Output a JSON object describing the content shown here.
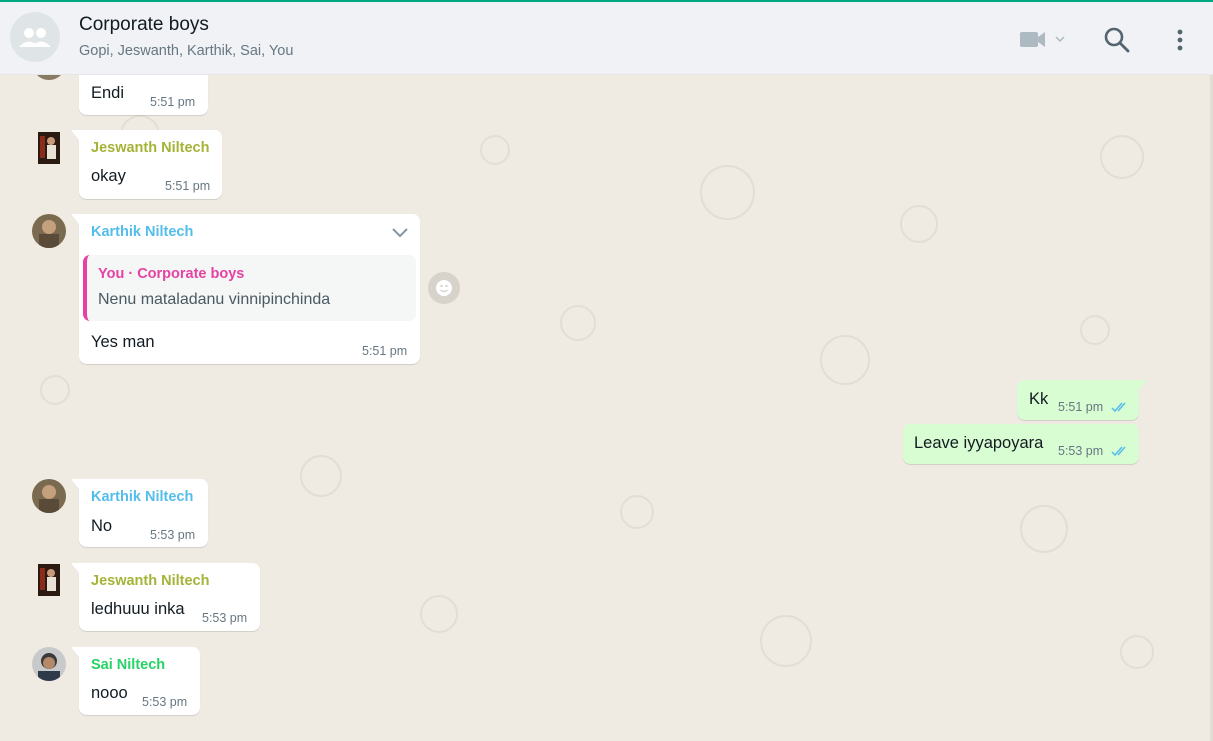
{
  "header": {
    "title": "Corporate boys",
    "members": "Gopi, Jeswanth, Karthik, Sai, You"
  },
  "colors": {
    "accent": "#00a884",
    "outgoing_bubble": "#d9fdd3",
    "incoming_bubble": "#ffffff",
    "chat_background": "#efeae2",
    "sender_jeswanth": "#a5b337",
    "sender_karthik": "#53bdeb",
    "sender_sai": "#25d366",
    "quote_you": "#e542a3",
    "read_ticks": "#53bdeb"
  },
  "icons": {
    "video_call": "video-camera-icon",
    "search": "search-icon",
    "menu": "vertical-dots-menu-icon",
    "group": "group-avatar-icon",
    "reaction": "emoji-reaction-icon",
    "message_menu": "chevron-down-icon",
    "read_receipt": "double-check-icon"
  },
  "messages": [
    {
      "type": "incoming",
      "text": "Endi",
      "time": "5:51 pm"
    },
    {
      "type": "incoming",
      "sender": "Jeswanth Niltech",
      "text": "okay",
      "time": "5:51 pm"
    },
    {
      "type": "incoming",
      "sender": "Karthik Niltech",
      "quote": {
        "sender": "You · Corporate boys",
        "text": "Nenu mataladanu vinnipinchinda"
      },
      "text": "Yes man",
      "time": "5:51 pm"
    },
    {
      "type": "outgoing",
      "text": "Kk",
      "time": "5:51 pm",
      "status": "read"
    },
    {
      "type": "outgoing",
      "text": "Leave iyyapoyara",
      "time": "5:53 pm",
      "status": "read"
    },
    {
      "type": "incoming",
      "sender": "Karthik Niltech",
      "text": "No",
      "time": "5:53 pm"
    },
    {
      "type": "incoming",
      "sender": "Jeswanth Niltech",
      "text": "ledhuuu inka",
      "time": "5:53 pm"
    },
    {
      "type": "incoming",
      "sender": "Sai Niltech",
      "text": "nooo",
      "time": "5:53 pm"
    }
  ]
}
